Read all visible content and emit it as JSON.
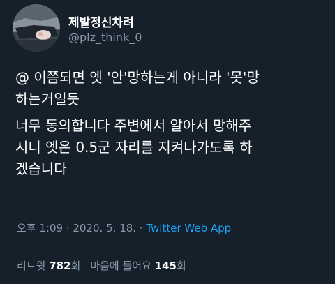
{
  "user": {
    "display_name": "제발정신차려",
    "handle": "@plz_think_0",
    "avatar_icon": "profile-photo"
  },
  "tweet": {
    "paragraph1_line1": "@ 이쯤되면 엣 '안'망하는게 아니라 '못'망",
    "paragraph1_line2": "하는거일듯",
    "paragraph2_line1": "너무 동의합니다 주변에서 알아서 망해주",
    "paragraph2_line2": "시니 엣은 0.5군 자리를 지켜나가도록 하",
    "paragraph2_line3": "겠습니다"
  },
  "meta": {
    "time": "오후 1:09",
    "separator1": " · ",
    "date": "2020. 5. 18.",
    "separator2": " · ",
    "source": "Twitter Web App"
  },
  "stats": {
    "retweets_label": "리트윗",
    "retweets_count": "782",
    "retweets_suffix": "회",
    "likes_label": "마음에 들어요",
    "likes_count": "145",
    "likes_suffix": "회"
  },
  "colors": {
    "background": "#15202b",
    "secondary_text": "#8899a6",
    "link": "#1da1f2",
    "divider": "#38444d"
  }
}
